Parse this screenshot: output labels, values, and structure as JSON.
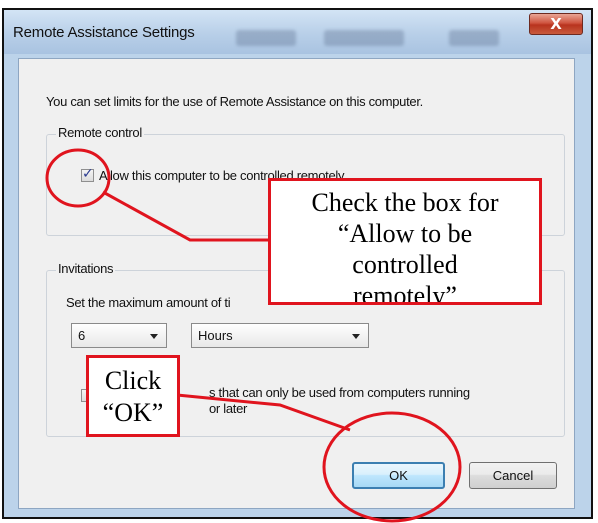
{
  "dialog": {
    "title": "Remote Assistance Settings",
    "close_glyph": "X",
    "intro": "You can set limits for the use of Remote Assistance on this computer.",
    "remote_control": {
      "group_label": "Remote control",
      "checkbox_label": "Allow this computer to be controlled remotely",
      "checked": true
    },
    "invitations": {
      "group_label": "Invitations",
      "max_time_label": "Set the maximum amount of ti",
      "duration_value": "6",
      "duration_unit": "Hours",
      "vista_checkbox_label_line1": "s that can only be used from computers running",
      "vista_checkbox_label_line2": "or later"
    },
    "ok_label": "OK",
    "cancel_label": "Cancel"
  },
  "annotations": {
    "allow_callout": [
      "Check the box for",
      "“Allow to be",
      "controlled",
      "remotely”"
    ],
    "ok_callout": [
      "Click",
      "“OK”"
    ],
    "accent_color": "#e0141e"
  }
}
